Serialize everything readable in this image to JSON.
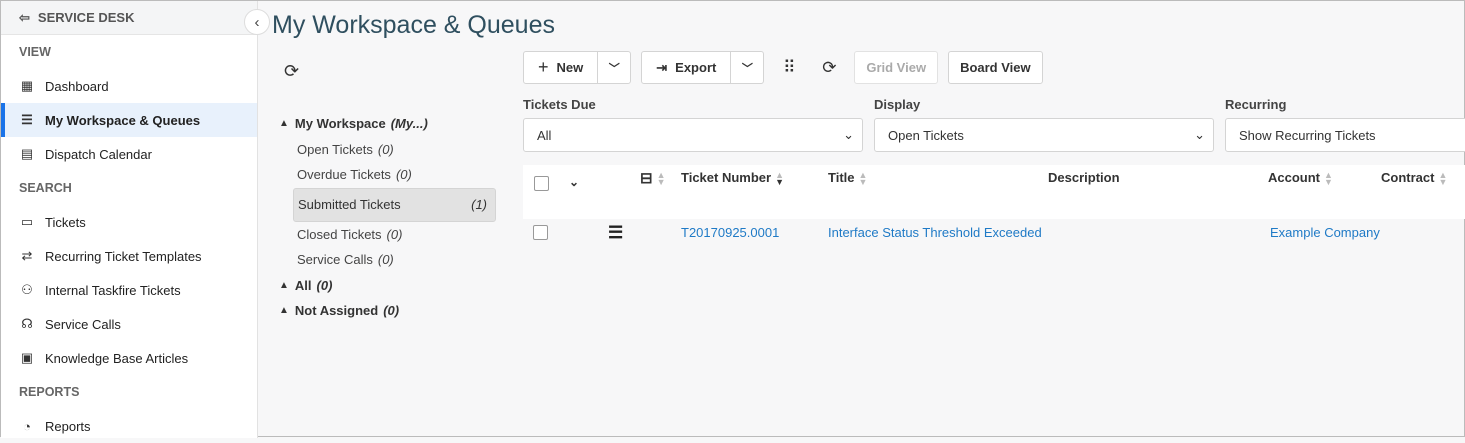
{
  "sidebar": {
    "header": "SERVICE DESK",
    "sections": [
      {
        "label": "VIEW",
        "items": [
          {
            "label": "Dashboard",
            "icon": "dashboard-icon"
          },
          {
            "label": "My Workspace & Queues",
            "icon": "checklist-icon",
            "active": true
          },
          {
            "label": "Dispatch Calendar",
            "icon": "calendar-icon"
          }
        ]
      },
      {
        "label": "SEARCH",
        "items": [
          {
            "label": "Tickets",
            "icon": "ticket-icon"
          },
          {
            "label": "Recurring Ticket Templates",
            "icon": "recurring-icon"
          },
          {
            "label": "Internal Taskfire Tickets",
            "icon": "people-icon"
          },
          {
            "label": "Service Calls",
            "icon": "headset-icon"
          },
          {
            "label": "Knowledge Base Articles",
            "icon": "book-icon"
          }
        ]
      },
      {
        "label": "REPORTS",
        "items": [
          {
            "label": "Reports",
            "icon": "chart-pie-icon"
          }
        ]
      }
    ]
  },
  "page_title": "My Workspace & Queues",
  "tree": {
    "my_workspace": {
      "label": "My Workspace",
      "note": "(My...)"
    },
    "children": [
      {
        "label": "Open Tickets",
        "count": "(0)"
      },
      {
        "label": "Overdue Tickets",
        "count": "(0)"
      },
      {
        "label": "Submitted Tickets",
        "count": "(1)"
      },
      {
        "label": "Closed Tickets",
        "count": "(0)"
      },
      {
        "label": "Service Calls",
        "count": "(0)"
      }
    ],
    "all": {
      "label": "All",
      "count": "(0)"
    },
    "not_assigned": {
      "label": "Not Assigned",
      "count": "(0)"
    }
  },
  "toolbar": {
    "new": "New",
    "export": "Export",
    "grid_view": "Grid View",
    "board_view": "Board View"
  },
  "filters": {
    "tickets_due": {
      "label": "Tickets Due",
      "value": "All"
    },
    "display": {
      "label": "Display",
      "value": "Open Tickets"
    },
    "recurring": {
      "label": "Recurring",
      "value": "Show Recurring Tickets"
    }
  },
  "table": {
    "columns": {
      "ticket_number": "Ticket Number",
      "title": "Title",
      "description": "Description",
      "account": "Account",
      "contract": "Contract"
    },
    "rows": [
      {
        "ticket_number": "T20170925.0001",
        "title": "Interface Status Threshold Exceeded",
        "description": "",
        "account": "Example Company",
        "contract": ""
      }
    ]
  }
}
